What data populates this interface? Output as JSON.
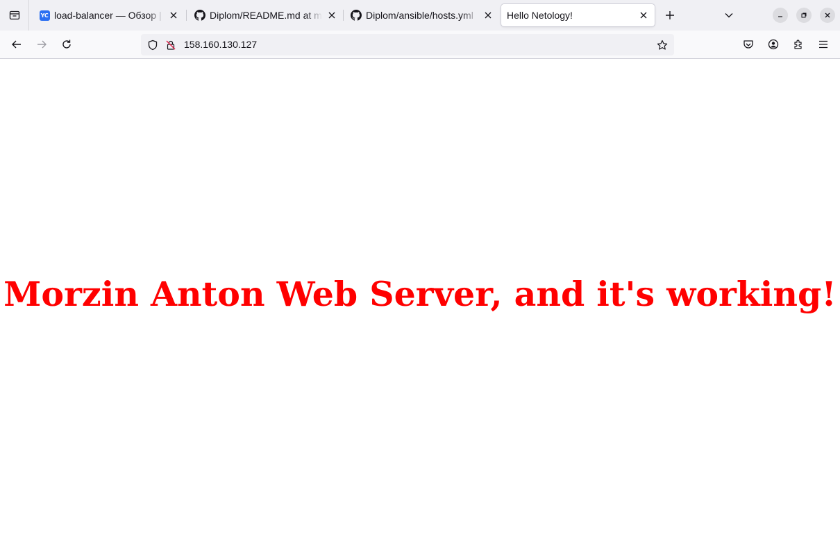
{
  "tabs": [
    {
      "title": "load-balancer — Обзор | Yandex Cloud",
      "favicon": "yandex-cloud-logo",
      "favicon_text": "YC",
      "selected": false
    },
    {
      "title": "Diplom/README.md at main",
      "favicon": "github-icon",
      "selected": false
    },
    {
      "title": "Diplom/ansible/hosts.yml",
      "favicon": "github-icon",
      "selected": false
    },
    {
      "title": "Hello Netology!",
      "favicon": "none",
      "selected": true
    }
  ],
  "address_bar": {
    "url": "158.160.130.127"
  },
  "page": {
    "headline": "Morzin Anton Web Server, and it's working!"
  },
  "colors": {
    "headline": "#ff0000",
    "tabbar_bg": "#f0f0f4",
    "navbar_bg": "#f9f9fb",
    "yc_blue": "#2a6ff2"
  }
}
